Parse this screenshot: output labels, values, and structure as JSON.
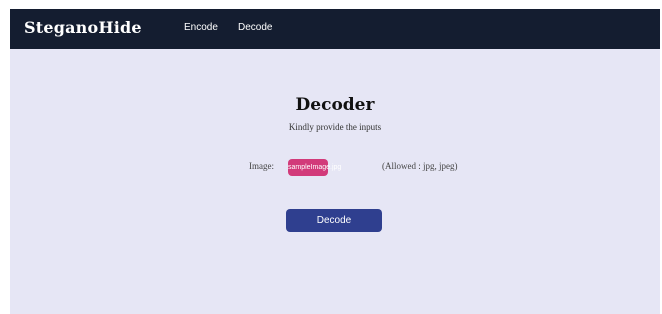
{
  "navbar": {
    "brand": "SteganoHide",
    "links": [
      {
        "label": "Encode"
      },
      {
        "label": "Decode"
      }
    ],
    "background_color": "#141d30"
  },
  "main": {
    "title": "Decoder",
    "subtitle": "Kindly provide the inputs",
    "image_field": {
      "label": "Image:",
      "file_name": "sampleImage.jpg",
      "allowed_text": "(Allowed : jpg, jpeg)"
    },
    "decode_button_label": "Decode",
    "background_color": "#e6e6f5"
  },
  "colors": {
    "file_chip": "#d23a7a",
    "button": "#2f3f8f"
  }
}
